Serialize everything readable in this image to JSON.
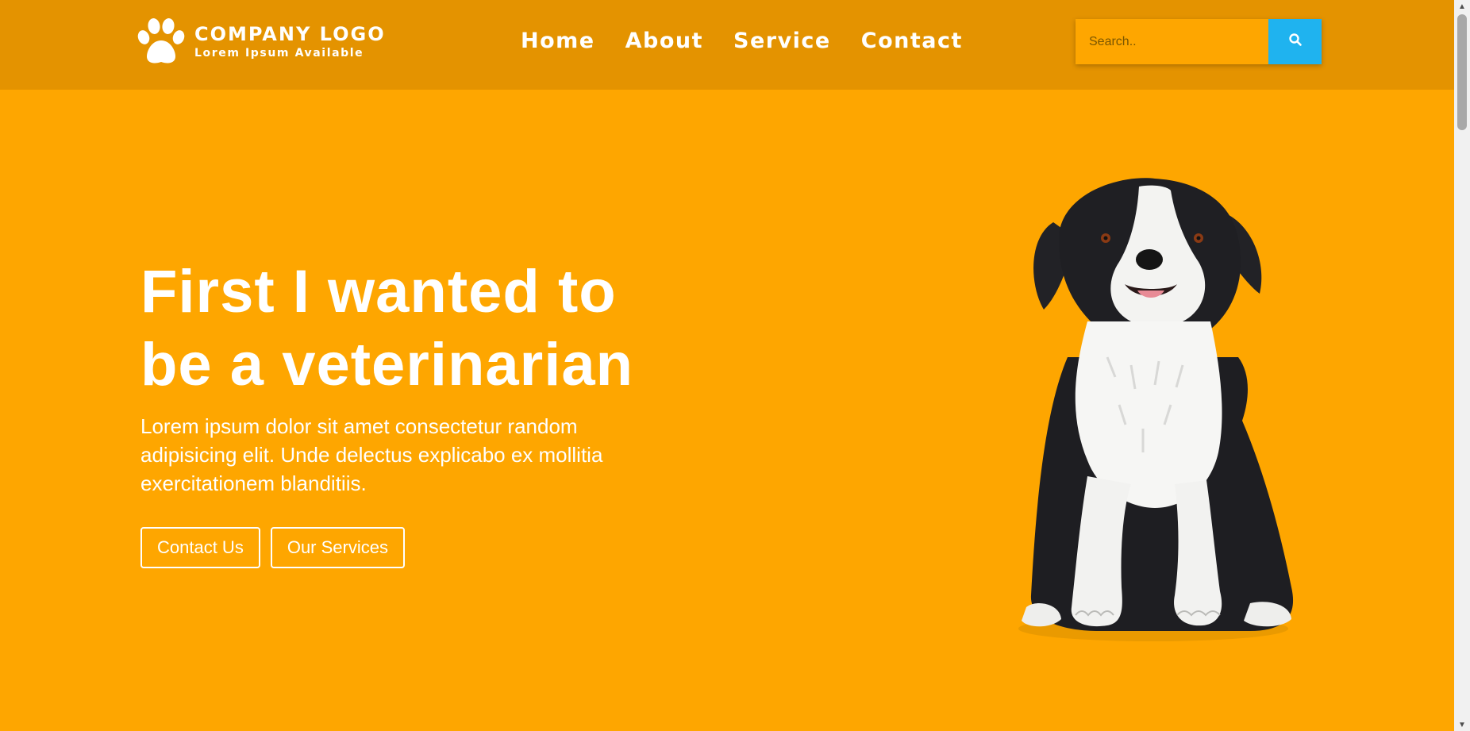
{
  "header": {
    "logo_title": "COMPANY LOGO",
    "logo_subtitle": "Lorem Ipsum Available",
    "logo_icon": "paw-icon"
  },
  "nav": {
    "items": [
      {
        "label": "Home"
      },
      {
        "label": "About"
      },
      {
        "label": "Service"
      },
      {
        "label": "Contact"
      }
    ]
  },
  "search": {
    "placeholder": "Search..",
    "value": "",
    "button_icon": "search-icon"
  },
  "hero": {
    "title": "First I wanted to be a veterinarian",
    "description": "Lorem ipsum dolor sit amet consectetur random adipisicing elit. Unde delectus explicabo ex mollitia exercitationem blanditiis.",
    "primary_button": "Contact Us",
    "secondary_button": "Our Services",
    "image": "dog-image"
  },
  "colors": {
    "header_bg": "#e49300",
    "hero_bg": "#fea600",
    "search_button": "#1fb3ef",
    "text": "#ffffff"
  }
}
